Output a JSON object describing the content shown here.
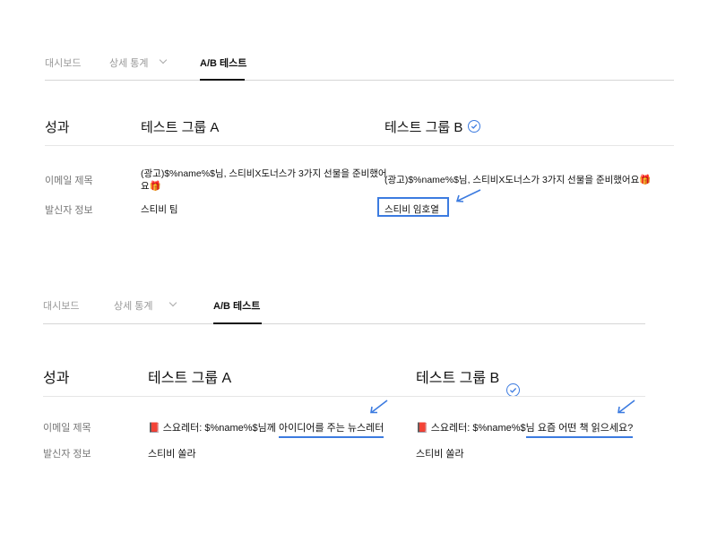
{
  "panel1": {
    "tabs": [
      "대시보드",
      "상세 통계",
      "A/B 테스트"
    ],
    "header": {
      "perf": "성과",
      "group_a": "테스트 그룹 A",
      "group_b": "테스트 그룹 B"
    },
    "rows": {
      "subject_label": "이메일 제목",
      "sender_label": "발신자 정보",
      "a_subject_line1": "(광고)$%name%$님, 스티비X도너스가 3가지 선물을 준비했어",
      "a_subject_line2": "요🎁",
      "b_subject": "(광고)$%name%$님, 스티비X도너스가 3가지 선물을 준비했어요🎁",
      "a_sender": "스티비 팀",
      "b_sender": "스티비 임호열"
    }
  },
  "panel2": {
    "tabs": [
      "대시보드",
      "상세 통계",
      "A/B 테스트"
    ],
    "header": {
      "perf": "성과",
      "group_a": "테스트 그룹 A",
      "group_b": "테스트 그룹 B"
    },
    "rows": {
      "subject_label": "이메일 제목",
      "sender_label": "발신자 정보",
      "a_subject_prefix": "📕 스요레터: $%name%$님께 ",
      "a_subject_highlight": "아이디어를 주는 뉴스레터",
      "b_subject_prefix": "📕 스요레터: $%name%$",
      "b_subject_highlight": "님 요즘 어떤 책 읽으세요?",
      "a_sender": "스티비 쏠라",
      "b_sender": "스티비 쏠라"
    }
  },
  "colors": {
    "accent": "#3c7be0",
    "text": "#111111",
    "muted": "#777777"
  },
  "icons": [
    "chevron-down-icon",
    "check-circle-icon",
    "annotation-arrow-icon"
  ]
}
